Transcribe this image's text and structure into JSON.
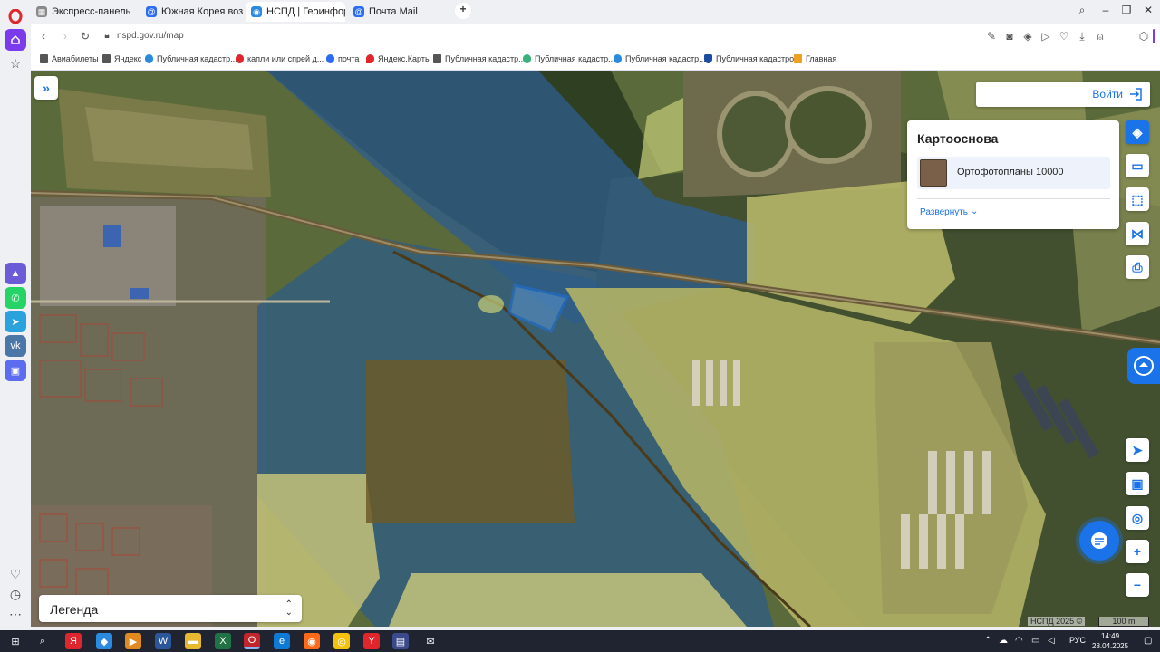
{
  "browser": {
    "tabs": [
      {
        "label": "Экспресс-панель"
      },
      {
        "label": "Южная Корея возмутила"
      },
      {
        "label": "НСПД | Геоинформацио"
      },
      {
        "label": "Почта Mail"
      }
    ],
    "url": "nspd.gov.ru/map",
    "bookmarks": [
      {
        "label": "Авиабилеты"
      },
      {
        "label": "Яндекс"
      },
      {
        "label": "Публичная кадастр..."
      },
      {
        "label": "капли или спрей д..."
      },
      {
        "label": "почта"
      },
      {
        "label": "Яндекс.Карты"
      },
      {
        "label": "Публичная кадастр..."
      },
      {
        "label": "Публичная кадастр..."
      },
      {
        "label": "Публичная кадастр..."
      },
      {
        "label": "Публичная кадастро..."
      },
      {
        "label": "Главная"
      }
    ]
  },
  "map": {
    "login_label": "Войти",
    "basemap": {
      "title": "Картооснова",
      "item_label": "Ортофотопланы 10000",
      "expand_label": "Развернуть"
    },
    "legend_label": "Легенда",
    "copyright": "НСПД 2025 ©",
    "scale_label": "100 m",
    "colors": {
      "accent": "#1a73e8",
      "parcel_yellow": "#e8e27a",
      "zone_blue": "#3c7fc9"
    }
  },
  "taskbar": {
    "language": "РУС",
    "time": "14:49",
    "date": "28.04.2025"
  }
}
